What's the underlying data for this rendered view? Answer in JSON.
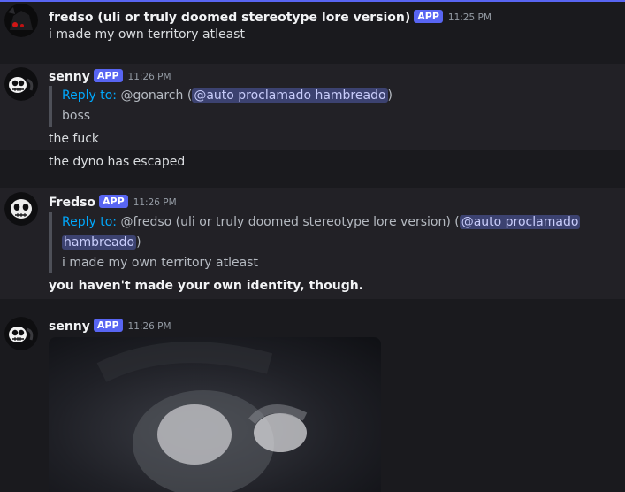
{
  "messages": [
    {
      "author": "fredso (uli or truly doomed stereotype lore version)",
      "badge": "APP",
      "time": "11:25 PM",
      "lines": [
        "i made my own territory atleast"
      ]
    },
    {
      "author": "senny",
      "badge": "APP",
      "time": "11:26 PM",
      "reply": {
        "prefix": "Reply to:",
        "target": "@gonarch",
        "mention": "@auto proclamado hambreado",
        "quoted": "boss"
      },
      "lines": [
        "the fuck",
        "the dyno has escaped"
      ]
    },
    {
      "author": "Fredso",
      "badge": "APP",
      "time": "11:26 PM",
      "reply": {
        "prefix": "Reply to:",
        "target": "@fredso (uli or truly doomed stereotype lore version)",
        "mention_part1": "@auto proclamado",
        "mention_part2": "hambreado",
        "quoted": "i made my own territory atleast"
      },
      "lines": [
        "you haven't made your own identity, though."
      ]
    },
    {
      "author": "senny",
      "badge": "APP",
      "time": "11:26 PM"
    }
  ],
  "colors": {
    "accent": "#5865f2",
    "reply_link": "#00a8fc",
    "mention_bg": "#3c4270",
    "background": "#1a1a1e"
  },
  "icons": {
    "avatar_fredso": "dark-creature-avatar",
    "avatar_senny": "skull-face-avatar"
  }
}
